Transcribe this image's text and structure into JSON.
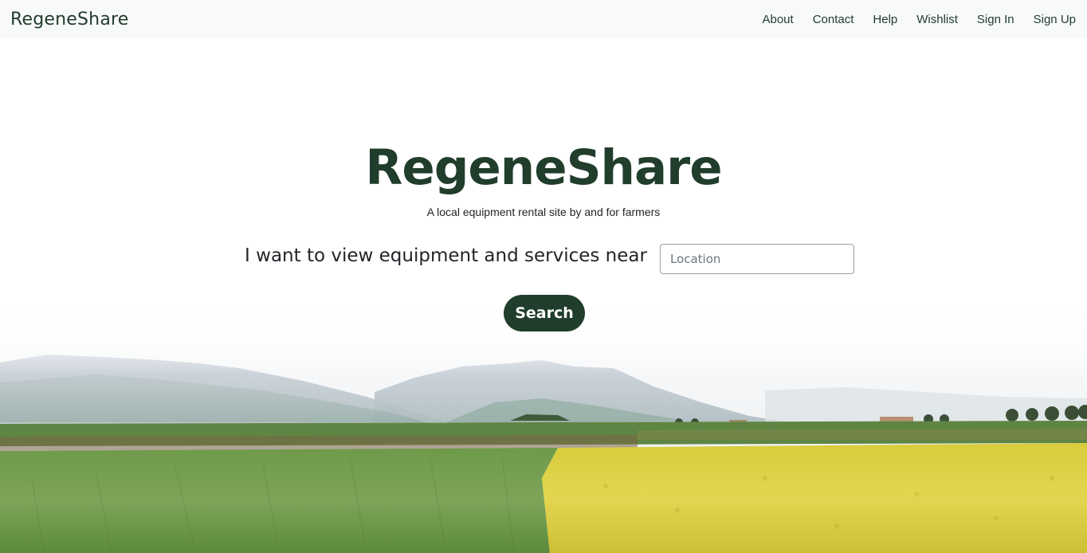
{
  "navbar": {
    "brand": "RegeneShare",
    "links": [
      "About",
      "Contact",
      "Help",
      "Wishlist",
      "Sign In",
      "Sign Up"
    ]
  },
  "hero": {
    "title": "RegeneShare",
    "subtitle": "A local equipment rental site by and for farmers",
    "search_prompt": "I want to view equipment and services near",
    "location_placeholder": "Location",
    "location_value": "",
    "search_button_label": "Search"
  },
  "colors": {
    "brand_green": "#213d2c",
    "navbar_bg": "#f8f9fa",
    "field_green": "#6f9a4a",
    "field_yellow": "#e0d14a"
  },
  "background_image": "farm-landscape-fields-mountains"
}
